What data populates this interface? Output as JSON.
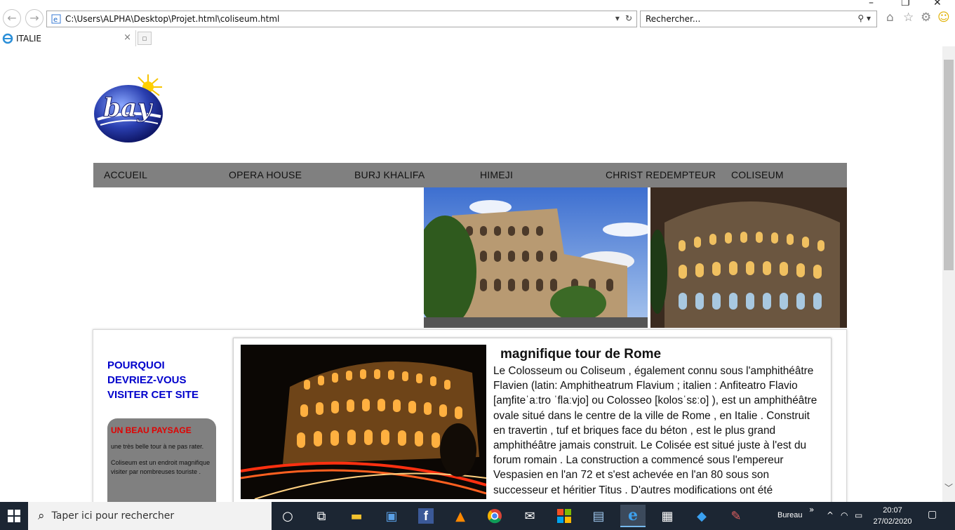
{
  "browser": {
    "address_url": "C:\\Users\\ALPHA\\Desktop\\Projet.html\\coliseum.html",
    "search_placeholder": "Rechercher...",
    "tab_title": "ITALIE",
    "tab_close": "×"
  },
  "page": {
    "menu": [
      "ACCUEIL",
      "OPERA HOUSE",
      "BURJ KHALIFA",
      "HIMEJI",
      "CHRIST REDEMPTEUR",
      "COLISEUM"
    ],
    "sidebar_title": "POURQUOI DEVRIEZ-VOUS VISITER CET SITE",
    "card": {
      "title": "UN BEAU PAYSAGE",
      "p1": "une très belle tour à ne pas rater.",
      "p2": "Coliseum est un endroit magnifique visiter par nombreuses touriste ."
    },
    "article": {
      "title": "magnifique tour de Rome",
      "text": "Le Colosseum ou Coliseum , également connu sous l'amphithéâtre Flavien (latin: Amphitheatrum Flavium ; italien : Anfiteatro Flavio [aɱfiteˈaːtro ˈflaːvjo] ou Colosseo [kolosˈsɛːo] ), est un amphithéâtre ovale situé dans le centre de la ville de Rome , en Italie . Construit en travertin , tuf et briques face du béton , est le plus grand amphithéâtre jamais construit. Le Colisée est situé juste à l'est du forum romain . La construction a commencé sous l'empereur Vespasien en l'an 72 et s'est achevée en l'an 80 sous son successeur et héritier Titus . D'autres modifications ont été"
    }
  },
  "taskbar": {
    "search_placeholder": "Taper ici pour rechercher",
    "tray_label": "Bureau",
    "time": "20:07",
    "date": "27/02/2020"
  },
  "colors": {
    "menu_bg": "#808080",
    "sidebar_title": "#0000cc",
    "card_title": "#e00000",
    "taskbar_bg": "#1c2633"
  }
}
